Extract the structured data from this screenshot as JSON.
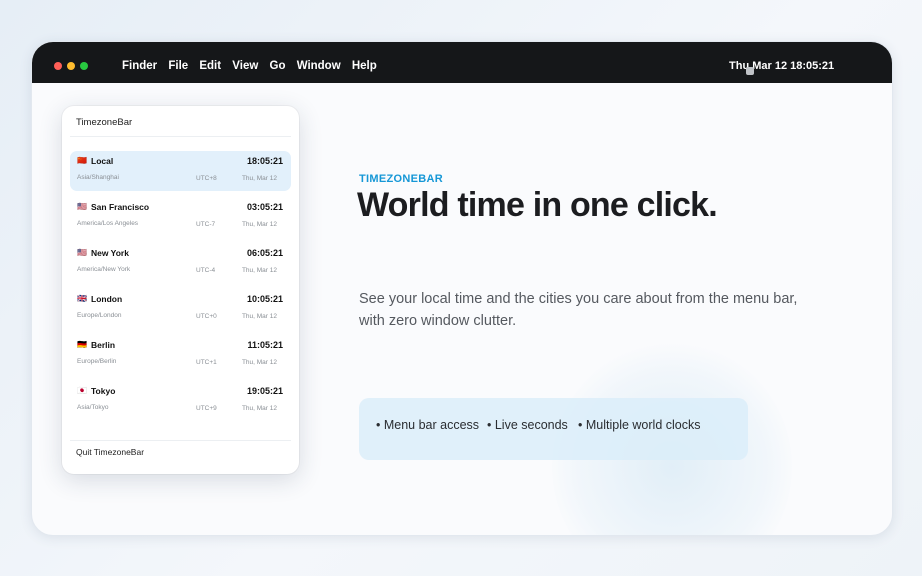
{
  "menubar": {
    "items": [
      "Finder",
      "File",
      "Edit",
      "View",
      "Go",
      "Window",
      "Help"
    ],
    "clock": "Thu Mar 12 18:05:21"
  },
  "popup": {
    "title": "TimezoneBar",
    "rows": [
      {
        "flag": "🇨🇳",
        "city": "Local",
        "time": "18:05:21",
        "timezone": "Asia/Shanghai",
        "offset": "UTC+8",
        "date": "Thu, Mar 12",
        "highlighted": true
      },
      {
        "flag": "🇺🇸",
        "city": "San Francisco",
        "time": "03:05:21",
        "timezone": "America/Los Angeles",
        "offset": "UTC-7",
        "date": "Thu, Mar 12",
        "highlighted": false
      },
      {
        "flag": "🇺🇸",
        "city": "New York",
        "time": "06:05:21",
        "timezone": "America/New York",
        "offset": "UTC-4",
        "date": "Thu, Mar 12",
        "highlighted": false
      },
      {
        "flag": "🇬🇧",
        "city": "London",
        "time": "10:05:21",
        "timezone": "Europe/London",
        "offset": "UTC+0",
        "date": "Thu, Mar 12",
        "highlighted": false
      },
      {
        "flag": "🇩🇪",
        "city": "Berlin",
        "time": "11:05:21",
        "timezone": "Europe/Berlin",
        "offset": "UTC+1",
        "date": "Thu, Mar 12",
        "highlighted": false
      },
      {
        "flag": "🇯🇵",
        "city": "Tokyo",
        "time": "19:05:21",
        "timezone": "Asia/Tokyo",
        "offset": "UTC+9",
        "date": "Thu, Mar 12",
        "highlighted": false
      }
    ],
    "quit_label": "Quit TimezoneBar"
  },
  "hero": {
    "eyebrow": "TIMEZONEBAR",
    "headline": "World time in one click.",
    "description": "See your local time and the cities you care about from the menu bar, with zero window clutter.",
    "features": [
      "• Menu bar access",
      "• Live seconds",
      "• Multiple world clocks"
    ]
  },
  "colors": {
    "accent": "#1597d6",
    "menubar_bg": "#151719",
    "row_highlight": "#e2f0fb",
    "feature_bg": "#dbedf9"
  }
}
